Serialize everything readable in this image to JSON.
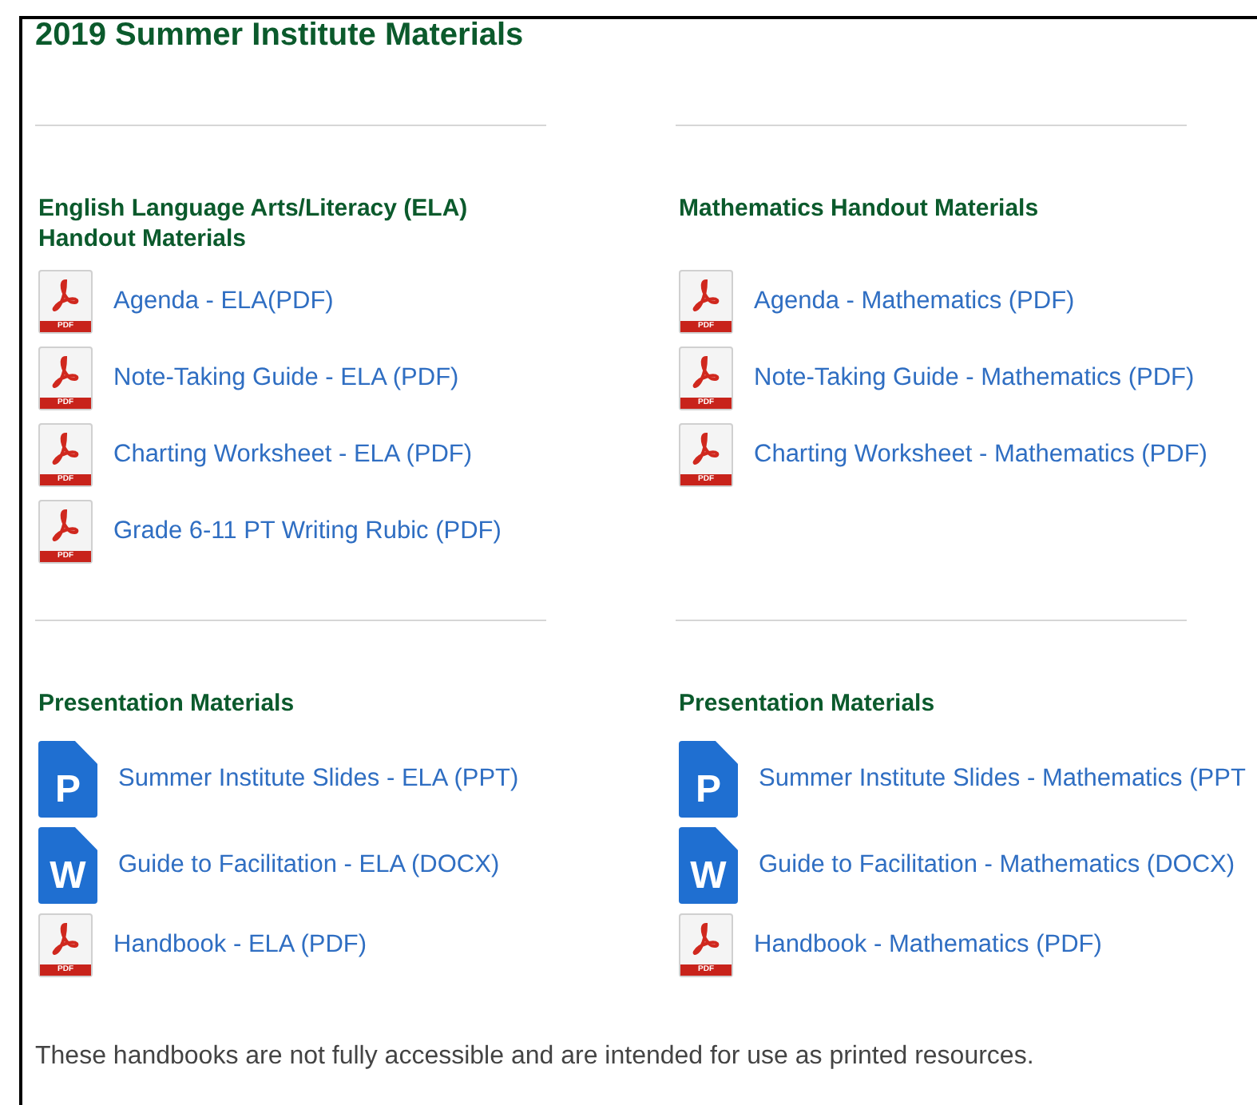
{
  "title": "2019 Summer Institute Materials",
  "sections": [
    {
      "columns": [
        {
          "heading": "English Language Arts/Literacy (ELA) Handout Materials",
          "items": [
            {
              "kind": "pdf",
              "icon_text": "PDF",
              "label": "Agenda - ELA(PDF)"
            },
            {
              "kind": "pdf",
              "icon_text": "PDF",
              "label": "Note-Taking Guide - ELA (PDF)"
            },
            {
              "kind": "pdf",
              "icon_text": "PDF",
              "label": "Charting Worksheet - ELA (PDF)"
            },
            {
              "kind": "pdf",
              "icon_text": "PDF",
              "label": "Grade 6-11 PT Writing Rubic (PDF)"
            }
          ]
        },
        {
          "heading": "Mathematics Handout Materials",
          "items": [
            {
              "kind": "pdf",
              "icon_text": "PDF",
              "label": "Agenda - Mathematics (PDF)"
            },
            {
              "kind": "pdf",
              "icon_text": "PDF",
              "label": "Note-Taking Guide - Mathematics (PDF)"
            },
            {
              "kind": "pdf",
              "icon_text": "PDF",
              "label": "Charting Worksheet - Mathematics (PDF)"
            }
          ]
        }
      ]
    },
    {
      "columns": [
        {
          "heading": "Presentation Materials",
          "items": [
            {
              "kind": "ppt",
              "icon_text": "P",
              "label": "Summer Institute Slides - ELA (PPT)"
            },
            {
              "kind": "docx",
              "icon_text": "W",
              "label": "Guide to Facilitation - ELA (DOCX)"
            },
            {
              "kind": "pdf",
              "icon_text": "PDF",
              "label": "Handbook - ELA (PDF)"
            }
          ]
        },
        {
          "heading": "Presentation Materials",
          "items": [
            {
              "kind": "ppt",
              "icon_text": "P",
              "label": "Summer Institute Slides - Mathematics (PPT"
            },
            {
              "kind": "docx",
              "icon_text": "W",
              "label": "Guide to Facilitation - Mathematics (DOCX)"
            },
            {
              "kind": "pdf",
              "icon_text": "PDF",
              "label": "Handbook - Mathematics (PDF)"
            }
          ]
        }
      ]
    }
  ],
  "note": "These handbooks are not fully accessible and are intended for use as printed resources."
}
